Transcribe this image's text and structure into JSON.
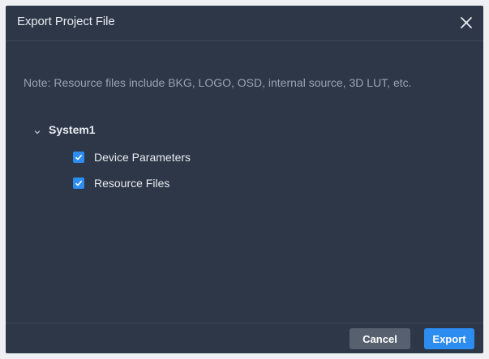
{
  "dialog": {
    "title": "Export Project File",
    "close_icon": "close-icon",
    "note": "Note: Resource files include BKG, LOGO, OSD, internal source, 3D LUT, etc."
  },
  "tree": {
    "root_label": "System1",
    "root_expanded": true,
    "items": [
      {
        "label": "Device Parameters",
        "checked": true
      },
      {
        "label": "Resource Files",
        "checked": true
      }
    ]
  },
  "footer": {
    "cancel_label": "Cancel",
    "export_label": "Export"
  },
  "colors": {
    "background": "#2d3748",
    "accent": "#2d8cf0",
    "secondary_button": "#56606e"
  }
}
